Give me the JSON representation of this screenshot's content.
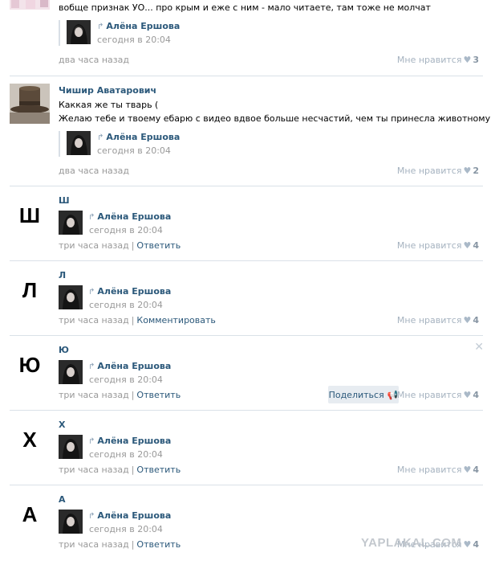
{
  "top_post": {
    "text": "вобще признак УО... про крым и еже с ним - мало читаете, там тоже не молчат",
    "repost": {
      "name": "Алёна Ершова",
      "date": "сегодня в 20:04"
    },
    "time": "два часа назад",
    "like_label": "Мне нравится",
    "like_count": "3"
  },
  "comment_chishir": {
    "author": "Чишир Аватарович",
    "line1": "Каккая же ты тварь (",
    "line2": "Желаю тебе и твоему ебарю с видео вдвое больше несчастий, чем ты принесла животному.",
    "repost": {
      "name": "Алёна Ершова",
      "date": "сегодня в 20:04"
    },
    "time": "два часа назад",
    "like_label": "Мне нравится",
    "like_count": "2"
  },
  "letter_posts": [
    {
      "avatar_letter": "Ш",
      "author": "Ш",
      "repost_name": "Алёна Ершова",
      "repost_date": "сегодня в 20:04",
      "time": "три часа назад",
      "action": "Ответить",
      "like_label": "Мне нравится",
      "like_count": "4"
    },
    {
      "avatar_letter": "Л",
      "author": "Л",
      "repost_name": "Алёна Ершова",
      "repost_date": "сегодня в 20:04",
      "time": "три часа назад",
      "action": "Комментировать",
      "like_label": "Мне нравится",
      "like_count": "4"
    },
    {
      "avatar_letter": "Ю",
      "author": "Ю",
      "repost_name": "Алёна Ершова",
      "repost_date": "сегодня в 20:04",
      "time": "три часа назад",
      "action": "Ответить",
      "like_label": "Мне нравится",
      "like_count": "4",
      "share_label": "Поделиться"
    },
    {
      "avatar_letter": "Х",
      "author": "Х",
      "repost_name": "Алёна Ершова",
      "repost_date": "сегодня в 20:04",
      "time": "три часа назад",
      "action": "Ответить",
      "like_label": "Мне нравится",
      "like_count": "4"
    },
    {
      "avatar_letter": "А",
      "author": "А",
      "repost_name": "Алёна Ершова",
      "repost_date": "сегодня в 20:04",
      "time": "три часа назад",
      "action": "Ответить",
      "like_label": "Мне нравится",
      "like_count": "4"
    }
  ],
  "watermark": "YAPLAKAL.COM",
  "colors": {
    "link": "#2b587a",
    "muted": "#999999",
    "separator": "#dae1e8",
    "share_bg": "#e7ecf1"
  }
}
